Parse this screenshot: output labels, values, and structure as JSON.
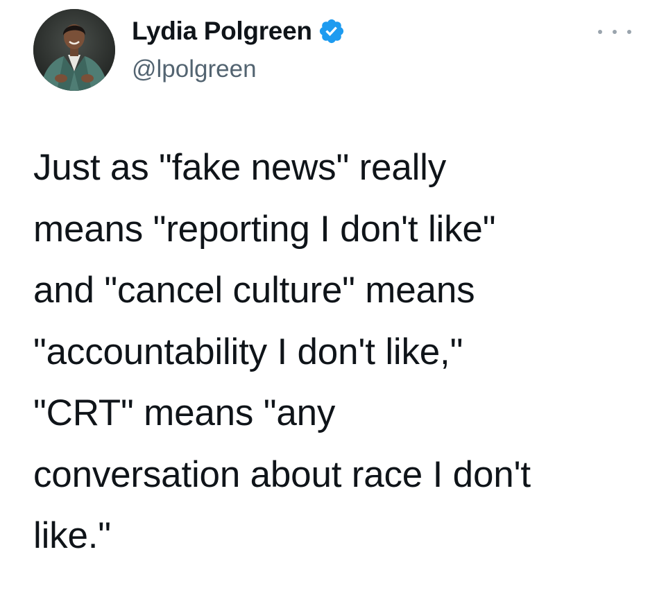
{
  "author": {
    "display_name": "Lydia Polgreen",
    "handle": "@lpolgreen",
    "verified": true,
    "avatar_icon": "profile-photo",
    "verified_icon": "verified-badge-icon"
  },
  "menu_icon": "more-options-icon",
  "tweet": {
    "lines": [
      "Just as \"fake news\" really",
      "means \"reporting I don't like\"",
      "and \"cancel culture\" means",
      "\"accountability I don't like,\"",
      "\"CRT\" means \"any",
      "conversation about race I don't",
      "like.\""
    ]
  },
  "colors": {
    "text": "#0f1419",
    "handle": "#536471",
    "verified": "#1d9bf0",
    "background": "#ffffff"
  }
}
